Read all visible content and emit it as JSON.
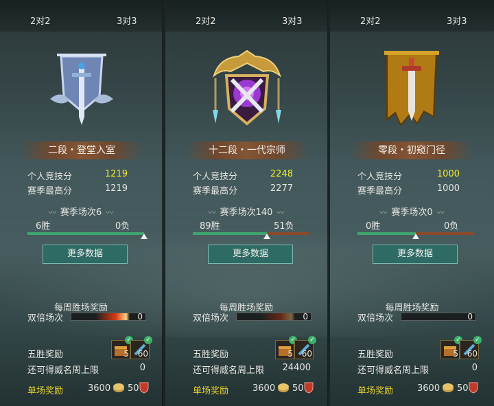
{
  "panels": [
    {
      "tabs": [
        "2对2",
        "3对3"
      ],
      "rank": "二段・登堂入室",
      "personal_label": "个人竞技分",
      "personal_value": "1219",
      "season_high_label": "赛季最高分",
      "season_high_value": "1219",
      "season_matches": "赛季场次6",
      "wins": "6胜",
      "losses": "0负",
      "win_ratio": 1.0,
      "more_button": "更多数据",
      "weekly_reward": "每周胜场奖励",
      "double_label": "双倍场次",
      "double_value": "0",
      "five_win_label": "五胜奖励",
      "item1_qty": "5",
      "item2_qty": "60",
      "fame_limit_label": "还可得威名周上限",
      "fame_limit_value": "0",
      "single_label": "单场奖励",
      "single_coins": "3600",
      "single_honor": "50"
    },
    {
      "tabs": [
        "2对2",
        "3对3"
      ],
      "rank": "十二段・一代宗师",
      "personal_label": "个人竞技分",
      "personal_value": "2248",
      "season_high_label": "赛季最高分",
      "season_high_value": "2277",
      "season_matches": "赛季场次140",
      "wins": "89胜",
      "losses": "51负",
      "win_ratio": 0.636,
      "more_button": "更多数据",
      "weekly_reward": "每周胜场奖励",
      "double_label": "双倍场次",
      "double_value": "0",
      "five_win_label": "五胜奖励",
      "item1_qty": "5",
      "item2_qty": "60",
      "fame_limit_label": "还可得威名周上限",
      "fame_limit_value": "24400",
      "single_label": "单场奖励",
      "single_coins": "3600",
      "single_honor": "50"
    },
    {
      "tabs": [
        "2对2",
        "3对3"
      ],
      "rank": "零段・初窥门径",
      "personal_label": "个人竞技分",
      "personal_value": "1000",
      "season_high_label": "赛季最高分",
      "season_high_value": "1000",
      "season_matches": "赛季场次0",
      "wins": "0胜",
      "losses": "0负",
      "win_ratio": 0.5,
      "more_button": "更多数据",
      "weekly_reward": "每周胜场奖励",
      "double_label": "双倍场次",
      "double_value": "0",
      "five_win_label": "五胜奖励",
      "item1_qty": "5",
      "item2_qty": "60",
      "fame_limit_label": "还可得威名周上限",
      "fame_limit_value": "0",
      "single_label": "单场奖励",
      "single_coins": "3600",
      "single_honor": "50"
    }
  ],
  "colors": {
    "score_highlight": "#f2ea2a",
    "win_bar": "#3fa56e",
    "loss_bar": "#8a4a2c",
    "single_reward_label": "#e5d12e"
  }
}
